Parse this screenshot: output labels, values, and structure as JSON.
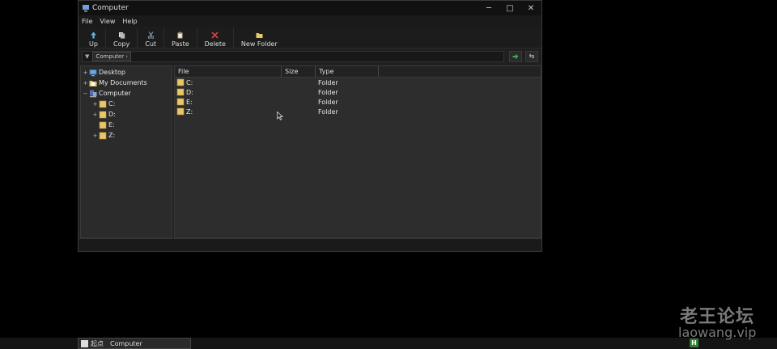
{
  "window": {
    "title": "Computer",
    "controls": {
      "minimize": "─",
      "maximize": "□",
      "close": "✕"
    }
  },
  "menu": [
    "File",
    "View",
    "Help"
  ],
  "toolbar": [
    {
      "label": "Up",
      "icon": "up-arrow-icon"
    },
    {
      "label": "Copy",
      "icon": "copy-icon"
    },
    {
      "label": "Cut",
      "icon": "scissors-icon"
    },
    {
      "label": "Paste",
      "icon": "paste-icon"
    },
    {
      "label": "Delete",
      "icon": "delete-x-icon"
    },
    {
      "label": "New Folder",
      "icon": "new-folder-icon"
    }
  ],
  "address": {
    "crumb": "Computer",
    "arrow": "›",
    "dropdown": "▼",
    "refresh": "⇆"
  },
  "tree": [
    {
      "label": "Desktop",
      "exp": "+",
      "icon": "desktop-icon"
    },
    {
      "label": "My Documents",
      "exp": "+",
      "icon": "documents-icon"
    },
    {
      "label": "Computer",
      "exp": "−",
      "icon": "computer-icon"
    },
    {
      "label": "C:",
      "exp": "+",
      "icon": "folder-icon"
    },
    {
      "label": "D:",
      "exp": "+",
      "icon": "folder-icon"
    },
    {
      "label": "E:",
      "exp": "",
      "icon": "folder-icon"
    },
    {
      "label": "Z:",
      "exp": "+",
      "icon": "folder-icon"
    }
  ],
  "file_list": {
    "columns": [
      "File",
      "Size",
      "Type"
    ],
    "rows": [
      {
        "name": "C:",
        "size": "",
        "type": "Folder"
      },
      {
        "name": "D:",
        "size": "",
        "type": "Folder"
      },
      {
        "name": "E:",
        "size": "",
        "type": "Folder"
      },
      {
        "name": "Z:",
        "size": "",
        "type": "Folder"
      }
    ]
  },
  "taskbar": {
    "start_label": "起点",
    "item": "Computer",
    "tray_letter": "H"
  },
  "watermark": {
    "line1": "老王论坛",
    "line2": "laowang.vip"
  },
  "colors": {
    "folder": "#e8c76a",
    "go_arrow": "#3fae49",
    "delete": "#d84040",
    "up": "#5bb0e6"
  }
}
